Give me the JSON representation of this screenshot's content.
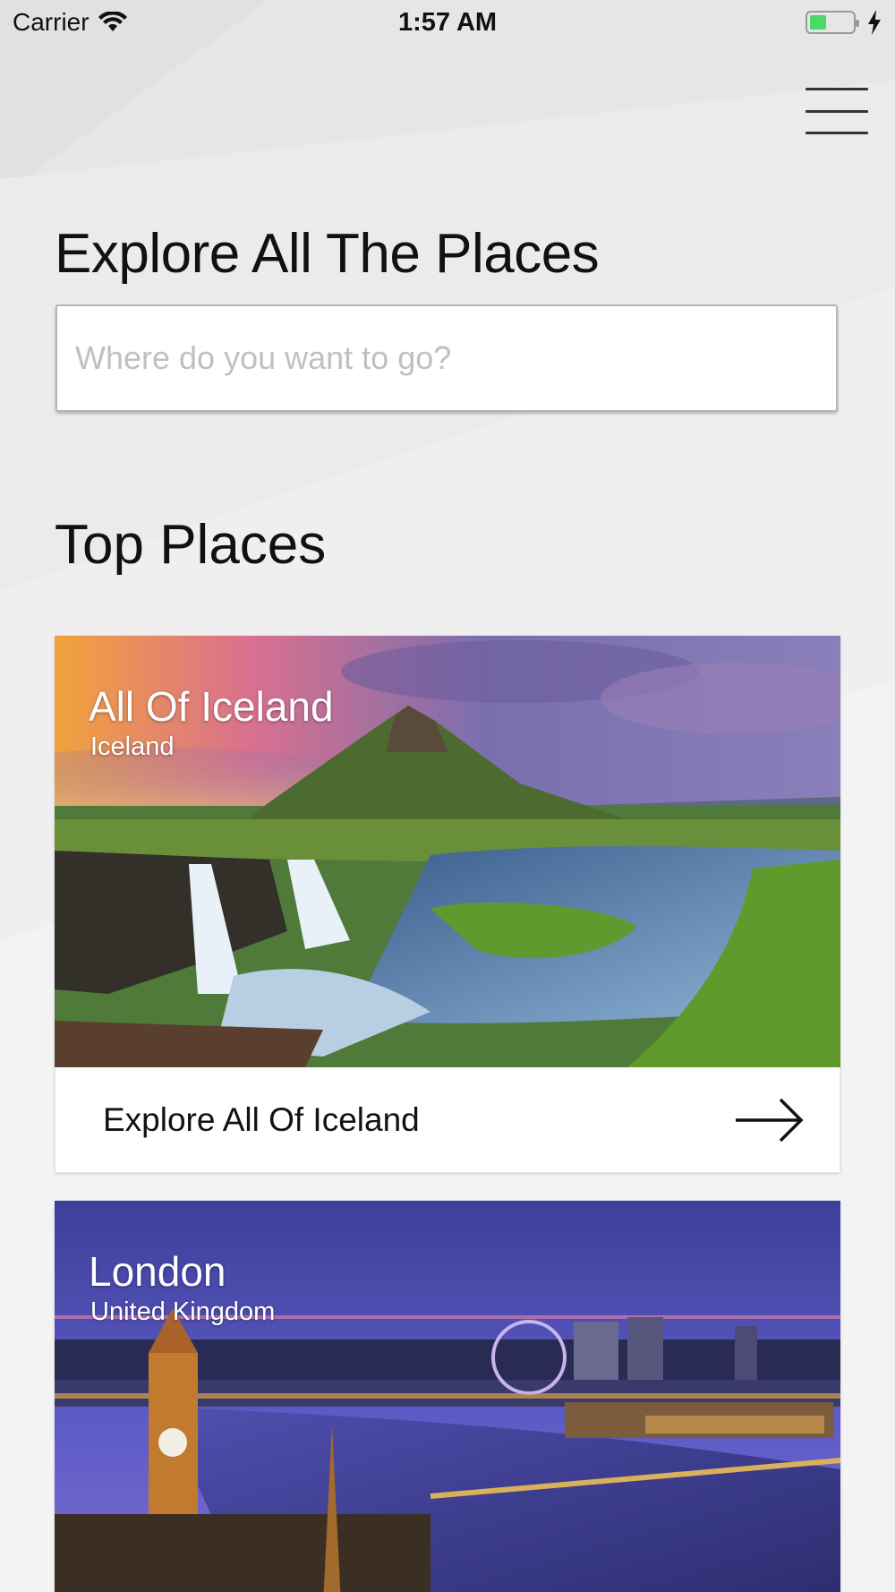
{
  "status_bar": {
    "carrier": "Carrier",
    "time": "1:57 AM",
    "battery_level": 0.4,
    "battery_color": "#4cd964"
  },
  "header": {
    "menu_icon": "hamburger-menu-icon",
    "title": "Explore All The Places"
  },
  "search": {
    "placeholder": "Where do you want to go?",
    "value": ""
  },
  "top_places": {
    "heading": "Top Places",
    "cards": [
      {
        "title": "All Of Iceland",
        "subtitle": "Iceland",
        "cta": "Explore All Of Iceland",
        "cta_icon": "arrow-right-icon"
      },
      {
        "title": "London",
        "subtitle": "United Kingdom"
      }
    ]
  }
}
